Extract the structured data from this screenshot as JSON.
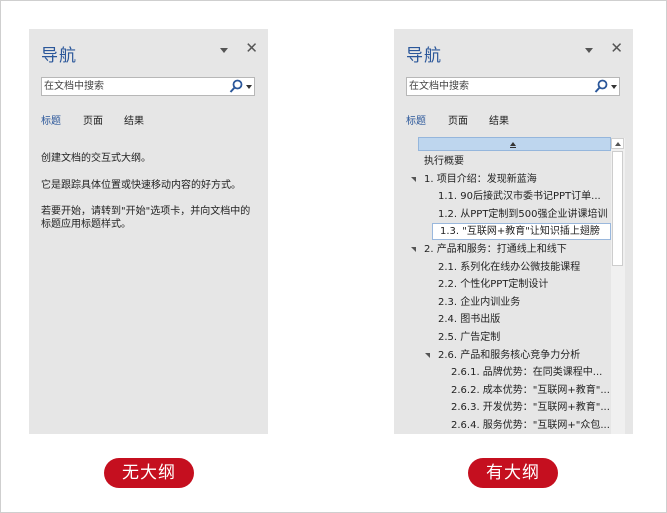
{
  "nav_title": "导航",
  "search_placeholder": "在文档中搜索",
  "tabs": [
    "标题",
    "页面",
    "结果"
  ],
  "left_pane": {
    "empty_lines": [
      "创建文档的交互式大纲。",
      "它是跟踪具体位置或快速移动内容的好方式。",
      "若要开始，请转到\"开始\"选项卡，并向文档中的标题应用标题样式。"
    ],
    "caption": "无大纲"
  },
  "right_pane": {
    "caption": "有大纲",
    "outline": [
      {
        "text": "执行概要",
        "level": 0,
        "expanded": null
      },
      {
        "text": "1.  项目介绍：发现新蓝海",
        "level": 0,
        "expanded": true
      },
      {
        "text": "1.1.  90后接武汉市委书记PPT订单...",
        "level": 1,
        "expanded": null
      },
      {
        "text": "1.2.  从PPT定制到500强企业讲课培训",
        "level": 1,
        "expanded": null
      },
      {
        "text": "1.3.  \"互联网+教育\"让知识插上翅膀",
        "level": 1,
        "expanded": null,
        "selected": true
      },
      {
        "text": "2.  产品和服务：打通线上和线下",
        "level": 0,
        "expanded": true
      },
      {
        "text": "2.1.  系列化在线办公微技能课程",
        "level": 1,
        "expanded": null
      },
      {
        "text": "2.2.  个性化PPT定制设计",
        "level": 1,
        "expanded": null
      },
      {
        "text": "2.3.  企业内训业务",
        "level": 1,
        "expanded": null
      },
      {
        "text": "2.4.  图书出版",
        "level": 1,
        "expanded": null
      },
      {
        "text": "2.5.  广告定制",
        "level": 1,
        "expanded": null
      },
      {
        "text": "2.6.  产品和服务核心竞争力分析",
        "level": 1,
        "expanded": true
      },
      {
        "text": "2.6.1.  品牌优势：在同类课程中...",
        "level": 2,
        "expanded": null
      },
      {
        "text": "2.6.2.  成本优势：\"互联网+教育\"...",
        "level": 2,
        "expanded": null
      },
      {
        "text": "2.6.3.  开发优势：\"互联网+教育\"...",
        "level": 2,
        "expanded": null
      },
      {
        "text": "2.6.4.  服务优势：\"互联网+\"众包...",
        "level": 2,
        "expanded": null
      }
    ]
  },
  "colors": {
    "accent": "#2b579a",
    "badge": "#c50f1f",
    "pane_bg": "#e6e6e6"
  }
}
